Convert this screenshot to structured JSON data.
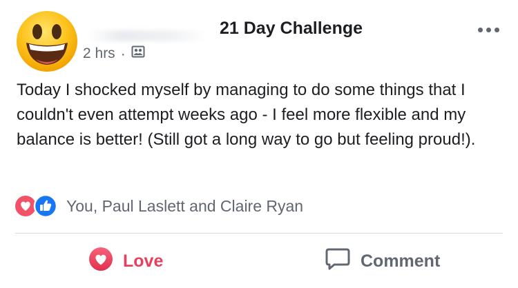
{
  "post": {
    "group_name": "21 Day Challenge",
    "timestamp": "2 hrs",
    "separator": "·",
    "audience_icon": "group-audience-icon",
    "avatar_icon": "grinning-face-emoji",
    "text": "Today I shocked myself by managing to do some things that I couldn't even attempt weeks ago - I feel more flexible and my balance is better! (Still got a long way to go but feeling proud!)."
  },
  "reactions": {
    "icons": [
      "love-reaction-icon",
      "like-reaction-icon"
    ],
    "names": "You, Paul Laslett and Claire Ryan"
  },
  "actions": {
    "love_label": "Love",
    "comment_label": "Comment"
  },
  "colors": {
    "love": "#e5405e",
    "like": "#1877f2",
    "secondary_text": "#606770",
    "primary_text": "#1c1e21"
  }
}
